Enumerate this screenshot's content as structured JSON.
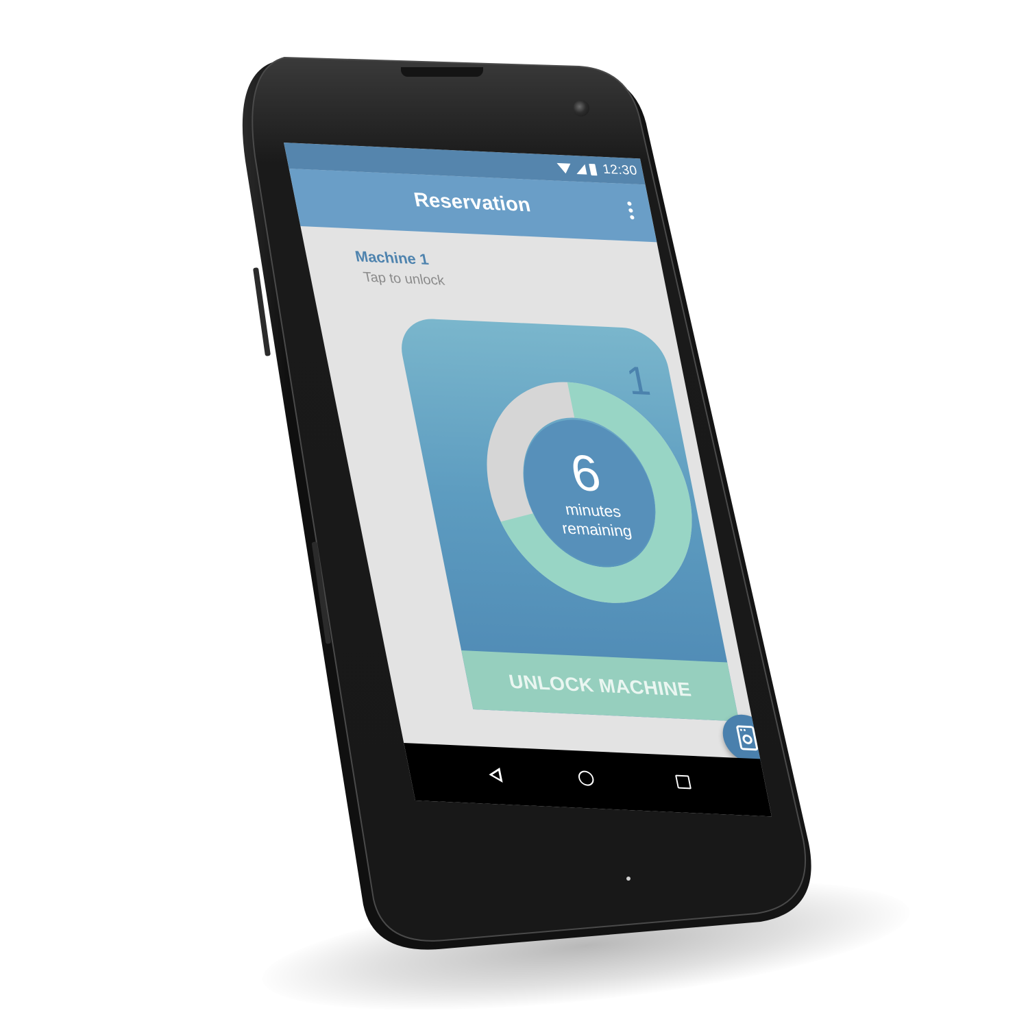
{
  "status_bar": {
    "time": "12:30",
    "icons": [
      "wifi-icon",
      "signal-icon",
      "battery-icon"
    ]
  },
  "app_bar": {
    "title": "Reservation",
    "menu_icon": "overflow-menu-icon"
  },
  "machine": {
    "name": "Machine 1",
    "hint": "Tap to unlock",
    "number": "1"
  },
  "timer": {
    "value": "6",
    "label_line1": "minutes",
    "label_line2": "remaining",
    "progress_remaining_fraction": 0.7
  },
  "unlock_button": {
    "label": "UNLOCK MACHINE"
  },
  "fab": {
    "icon": "washing-machine-icon"
  },
  "nav_bar": {
    "icons": [
      "back-icon",
      "home-icon",
      "recents-icon"
    ]
  },
  "colors": {
    "status_bar": "#5585ad",
    "app_bar": "#6a9ec7",
    "accent_mint": "#96cfbe",
    "ring_track": "#d6d6d6",
    "fab": "#4a80ad",
    "title_blue": "#4e83ae"
  }
}
